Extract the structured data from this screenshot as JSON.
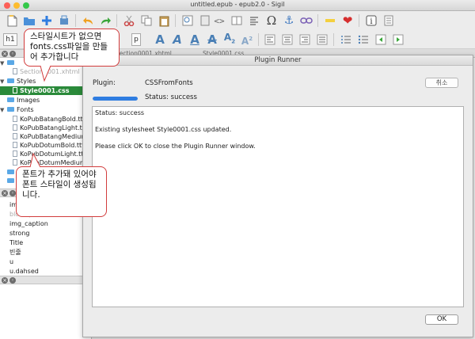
{
  "window": {
    "title": "untitled.epub - epub2.0 - Sigil"
  },
  "colors": {
    "close": "#fc5f57",
    "minimize": "#fdbc2e",
    "zoom": "#34c84a",
    "accent": "#2f7de1",
    "selection": "#2a8a3a",
    "callout_border": "#d23c3c"
  },
  "toolbar": {
    "heading_label": "h1",
    "paragraph_label": "p"
  },
  "book_browser": {
    "items": [
      {
        "label": "Section0001.xhtml",
        "kind": "file"
      },
      {
        "label": "Styles",
        "kind": "folder"
      },
      {
        "label": "Style0001.css",
        "kind": "file",
        "selected": true
      },
      {
        "label": "Images",
        "kind": "folder"
      },
      {
        "label": "Fonts",
        "kind": "folder"
      },
      {
        "label": "KoPubBatangBold.ttf",
        "kind": "file"
      },
      {
        "label": "KoPubBatangLight.ttf",
        "kind": "file"
      },
      {
        "label": "KoPubBatangMedium.ttf",
        "kind": "file"
      },
      {
        "label": "KoPubDotumBold.ttf",
        "kind": "file"
      },
      {
        "label": "KoPubDotumLight.ttf",
        "kind": "file"
      },
      {
        "label": "KoPubDotumMedium.ttf",
        "kind": "file"
      }
    ]
  },
  "styles_list": [
    "img_box",
    "blockquote",
    "img_caption",
    "strong",
    "Title",
    "빈줄",
    "u",
    "u.dahsed"
  ],
  "tabs": [
    "Section0001.xhtml",
    "Style0001.css"
  ],
  "callouts": {
    "top": "스타일시트가 없으면 fonts.css파일을 만들어 추가합니다",
    "bottom": "폰트가 추가돼 있어야 폰트 스타일이 생성됩니다."
  },
  "dialog": {
    "title": "Plugin Runner",
    "plugin_label": "Plugin:",
    "plugin_name": "CSSFromFonts",
    "cancel_label": "취소",
    "status_label": "Status: success",
    "progress": 1.0,
    "output_lines": [
      "Status: success",
      "Existing stylesheet Style0001.css updated.",
      "Please click OK to close the Plugin Runner window."
    ],
    "ok_label": "OK"
  }
}
